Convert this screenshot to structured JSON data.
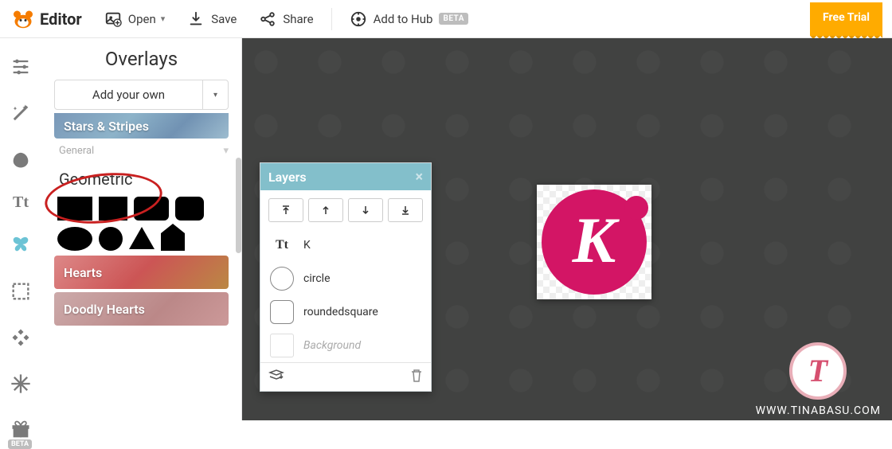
{
  "topbar": {
    "logo_label": "Editor",
    "open_label": "Open",
    "save_label": "Save",
    "share_label": "Share",
    "hub_label": "Add to Hub",
    "hub_badge": "BETA",
    "free_trial": "Free Trial"
  },
  "panel": {
    "title": "Overlays",
    "add_own": "Add your own",
    "cat_stars": "Stars & Stripes",
    "sub_general": "General",
    "group_geometric": "Geometric",
    "cat_hearts": "Hearts",
    "cat_doodly": "Doodly Hearts"
  },
  "layers": {
    "title": "Layers",
    "items": [
      {
        "type": "text",
        "label": "K"
      },
      {
        "type": "circle",
        "label": "circle"
      },
      {
        "type": "rsquare",
        "label": "roundedsquare"
      },
      {
        "type": "bg",
        "label": "Background"
      }
    ]
  },
  "artboard": {
    "letter": "K"
  },
  "watermark": {
    "initial": "T",
    "url": "WWW.TINABASU.COM"
  }
}
